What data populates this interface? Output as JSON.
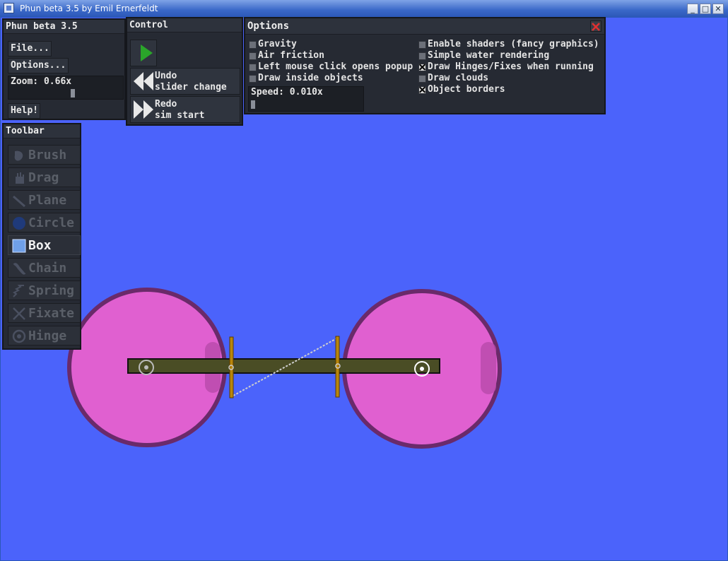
{
  "window": {
    "title": "Phun beta 3.5 by Emil Ernerfeldt"
  },
  "colors": {
    "background": "#4b63fb",
    "wheel_fill": "#e060d0",
    "wheel_rim": "#6a2a6a",
    "beam": "#4a4d25",
    "axle": "#b8860b"
  },
  "main_panel": {
    "title": "Phun beta 3.5",
    "file_label": "File...",
    "options_label": "Options...",
    "zoom_label": "Zoom: 0.66x",
    "zoom_value": 0.66,
    "help_label": "Help!"
  },
  "control_panel": {
    "title": "Control",
    "play_icon": "play-icon",
    "undo_line1": "Undo",
    "undo_line2": "slider change",
    "redo_line1": "Redo",
    "redo_line2": "sim start"
  },
  "options_panel": {
    "title": "Options",
    "close_icon": "close-icon",
    "left": [
      {
        "label": "Gravity",
        "checked": false
      },
      {
        "label": "Air friction",
        "checked": false
      },
      {
        "label": "Left mouse click opens popup",
        "checked": false
      },
      {
        "label": "Draw inside objects",
        "checked": false
      }
    ],
    "right": [
      {
        "label": "Enable shaders (fancy graphics)",
        "checked": false
      },
      {
        "label": "Simple water rendering",
        "checked": false
      },
      {
        "label": "Draw Hinges/Fixes when running",
        "checked": true
      },
      {
        "label": "Draw clouds",
        "checked": false
      },
      {
        "label": "Object borders",
        "checked": true
      }
    ],
    "speed_label": "Speed: 0.010x",
    "speed_value": 0.01
  },
  "toolbar": {
    "title": "Toolbar",
    "tools": [
      {
        "label": "Brush",
        "icon": "brush-icon",
        "active": false
      },
      {
        "label": "Drag",
        "icon": "drag-hand-icon",
        "active": false
      },
      {
        "label": "Plane",
        "icon": "plane-icon",
        "active": false
      },
      {
        "label": "Circle",
        "icon": "circle-icon",
        "active": false
      },
      {
        "label": "Box",
        "icon": "box-icon",
        "active": true
      },
      {
        "label": "Chain",
        "icon": "chain-icon",
        "active": false
      },
      {
        "label": "Spring",
        "icon": "spring-icon",
        "active": false
      },
      {
        "label": "Fixate",
        "icon": "fixate-icon",
        "active": false
      },
      {
        "label": "Hinge",
        "icon": "hinge-icon",
        "active": false
      }
    ]
  }
}
